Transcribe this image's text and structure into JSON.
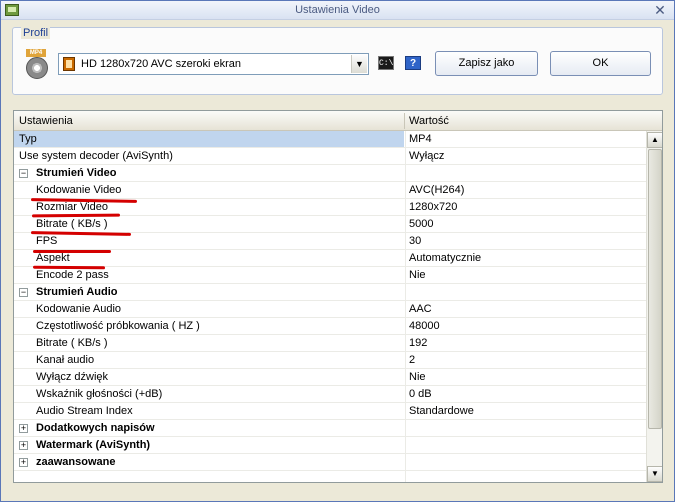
{
  "window": {
    "title": "Ustawienia Video"
  },
  "profil": {
    "legend": "Profil",
    "combo_value": "HD 1280x720 AVC szeroki ekran",
    "badge": "MP4",
    "save_label": "Zapisz jako",
    "ok_label": "OK"
  },
  "grid": {
    "col_settings": "Ustawienia",
    "col_value": "Wartość",
    "rows": [
      {
        "name": "Typ",
        "value": "MP4"
      },
      {
        "name": "Use system decoder (AviSynth)",
        "value": "Wyłącz"
      },
      {
        "name": "Strumień Video",
        "expander": "−"
      },
      {
        "name": "Kodowanie Video",
        "value": "AVC(H264)"
      },
      {
        "name": "Rozmiar Video",
        "value": "1280x720"
      },
      {
        "name": "Bitrate ( KB/s )",
        "value": "5000"
      },
      {
        "name": "FPS",
        "value": "30"
      },
      {
        "name": "Aspekt",
        "value": "Automatycznie"
      },
      {
        "name": "Encode 2 pass",
        "value": "Nie"
      },
      {
        "name": "Strumień Audio",
        "expander": "−"
      },
      {
        "name": "Kodowanie Audio",
        "value": "AAC"
      },
      {
        "name": "Częstotliwość próbkowania ( HZ )",
        "value": "48000"
      },
      {
        "name": "Bitrate ( KB/s )",
        "value": "192"
      },
      {
        "name": "Kanał audio",
        "value": "2"
      },
      {
        "name": "Wyłącz dźwięk",
        "value": "Nie"
      },
      {
        "name": "Wskaźnik głośności (+dB)",
        "value": "0 dB"
      },
      {
        "name": "Audio Stream Index",
        "value": "Standardowe"
      },
      {
        "name": "Dodatkowych napisów",
        "expander": "+"
      },
      {
        "name": "Watermark (AviSynth)",
        "expander": "+"
      },
      {
        "name": "zaawansowane",
        "expander": "+"
      }
    ]
  },
  "colors": {
    "selection": "#c0d5ee",
    "annotation": "#d40000",
    "titlebar_text": "#4b5b82"
  }
}
